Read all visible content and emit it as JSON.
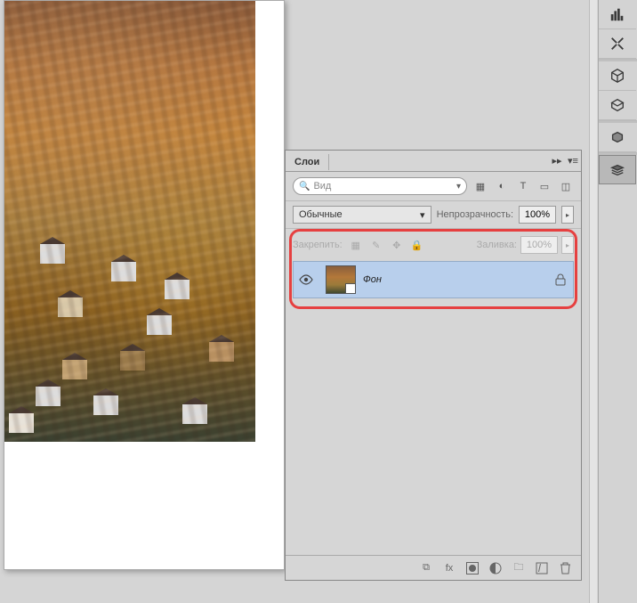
{
  "panel": {
    "title": "Слои",
    "search_label": "Вид",
    "blend_mode": "Обычные",
    "opacity_label": "Непрозрачность:",
    "opacity_value": "100%",
    "lock_label": "Закрепить:",
    "fill_label": "Заливка:",
    "fill_value": "100%"
  },
  "layers": [
    {
      "name": "Фон",
      "visible": true,
      "locked": true
    }
  ],
  "icons": {
    "image": "▦",
    "adjust": "◐",
    "type": "T",
    "shape": "▭",
    "smart": "◫",
    "lock_px": "▦",
    "brush": "✎",
    "move": "✥",
    "lock": "🔒",
    "eye": "👁",
    "link": "⧉",
    "fx": "fx",
    "mask": "◯",
    "fill": "◑",
    "folder": "🗀",
    "new": "⊞",
    "trash": "🗑"
  }
}
